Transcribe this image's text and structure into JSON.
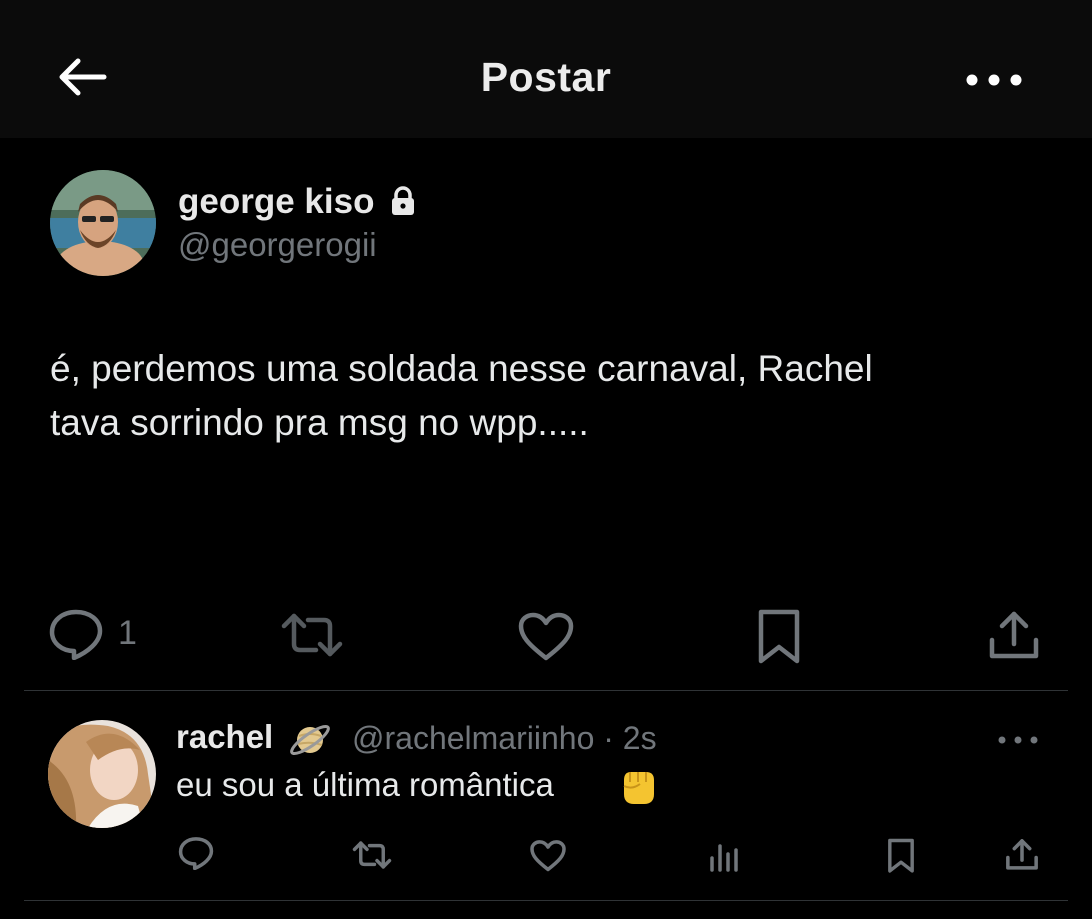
{
  "header": {
    "title": "Postar",
    "back_icon": "arrow-left-icon",
    "more_icon": "more-horizontal-icon"
  },
  "post": {
    "author_name": "george kiso",
    "author_handle": "@georgerogii",
    "protected_icon": "lock-icon",
    "text": "é, perdemos uma soldada nesse carnaval, Rachel\ntava sorrindo pra msg no wpp.....",
    "reply_count": "1",
    "actions": [
      "reply-icon",
      "retweet-icon",
      "like-icon",
      "bookmark-icon",
      "share-icon"
    ]
  },
  "reply": {
    "author_name": "rachel",
    "name_emoji": "ringed-planet-icon",
    "author_handle": "@rachelmariinho",
    "meta": "· 2s",
    "text": "eu sou a última romântica",
    "text_emoji": "raised-fist-icon",
    "actions": [
      "reply-icon",
      "retweet-icon",
      "like-icon",
      "views-icon",
      "bookmark-icon",
      "share-icon"
    ]
  },
  "colors": {
    "background": "#000000",
    "header_bg": "#0b0b0b",
    "text_primary": "#e7e9ea",
    "text_secondary": "#71767b",
    "divider": "#2f3336"
  }
}
